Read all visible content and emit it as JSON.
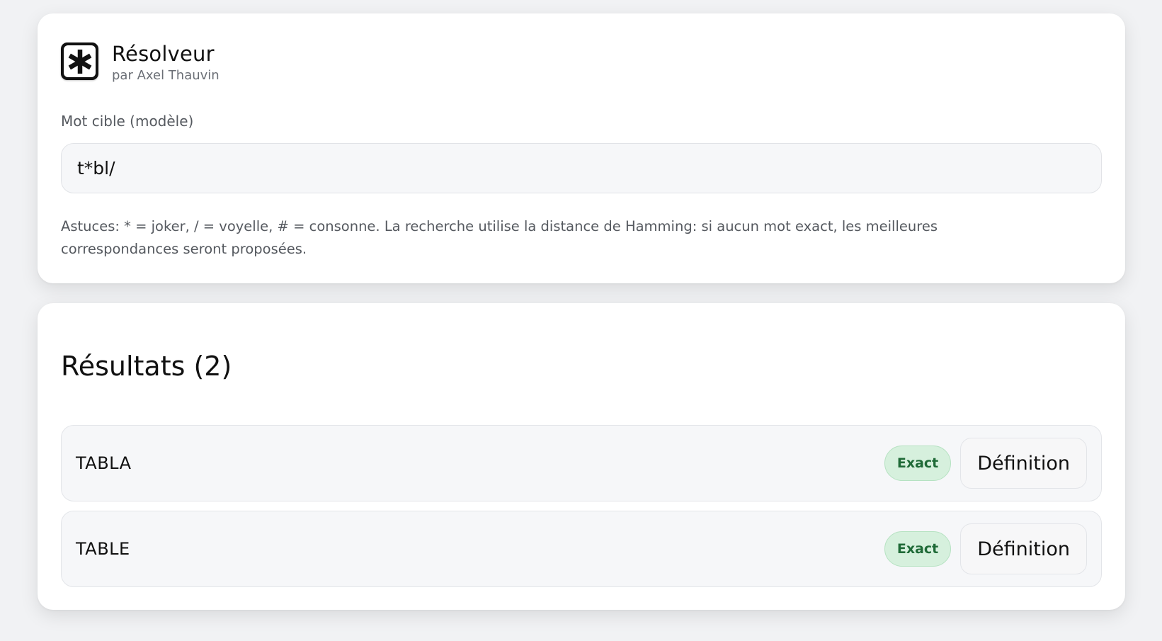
{
  "app": {
    "title": "Résolveur",
    "subtitle": "par Axel Thauvin",
    "logo_icon": "asterisk-icon"
  },
  "search": {
    "label": "Mot cible (modèle)",
    "value": "t*bl/",
    "hint": "Astuces: * = joker, / = voyelle, # = consonne. La recherche utilise la distance de Hamming: si aucun mot exact, les meilleures correspondances seront proposées."
  },
  "results": {
    "title": "Résultats (2)",
    "items": [
      {
        "word": "TABLA",
        "badge": "Exact",
        "button": "Définition"
      },
      {
        "word": "TABLE",
        "badge": "Exact",
        "button": "Définition"
      }
    ]
  },
  "colors": {
    "background": "#f1f2f4",
    "card": "#ffffff",
    "badge_bg": "#d6f0dd",
    "badge_text": "#1f6a37"
  }
}
